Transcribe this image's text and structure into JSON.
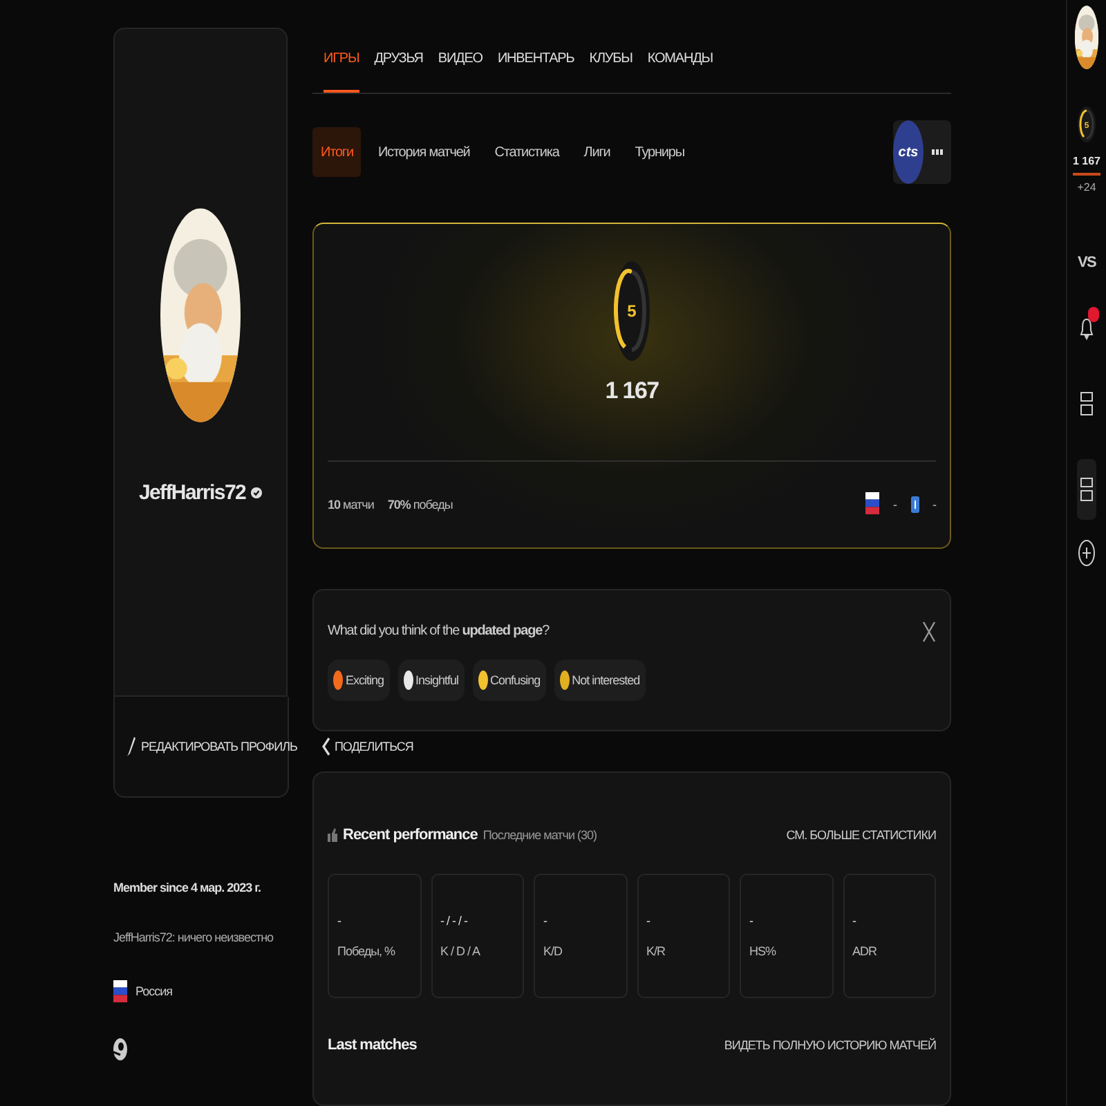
{
  "main_tabs": [
    {
      "label": "ИГРЫ",
      "selected": true
    },
    {
      "label": "ДРУЗЬЯ",
      "selected": false
    },
    {
      "label": "ВИДЕО",
      "selected": false
    },
    {
      "label": "ИНВЕНТАРЬ",
      "selected": false
    },
    {
      "label": "КЛУБЫ",
      "selected": false
    },
    {
      "label": "КОМАНДЫ",
      "selected": false
    }
  ],
  "sub_tabs": [
    {
      "label": "Итоги",
      "selected": true
    },
    {
      "label": "История матчей",
      "selected": false
    },
    {
      "label": "Статистика",
      "selected": false
    },
    {
      "label": "Лиги",
      "selected": false
    },
    {
      "label": "Турниры",
      "selected": false
    }
  ],
  "game_badge": "cts",
  "overview": {
    "level": "5",
    "elo": "1 167",
    "matches": "**10** матчи",
    "winrate": "**70%** победы",
    "country_value": "-",
    "region_value": "-"
  },
  "feedback": {
    "question": "What did you think of the **updated page**?",
    "options": [
      {
        "label": "Exciting",
        "color": "#f26b1d"
      },
      {
        "label": "Insightful",
        "color": "#e8e8e8"
      },
      {
        "label": "Confusing",
        "color": "#f2c12e"
      },
      {
        "label": "Not interested",
        "color": "#e0b020"
      }
    ]
  },
  "profile": {
    "name": "JeffHarris72",
    "edit_button": "РЕДАКТИРОВАТЬ ПРОФИЛЬ",
    "share_button": "ПОДЕЛИТЬСЯ",
    "member_since": "Member since 4 мар. 2023 г.",
    "bio": "JeffHarris72: ничего неизвестно",
    "country": "Россия"
  },
  "performance": {
    "title": "Recent performance",
    "subtitle": "Последние матчи (30)",
    "more_link": "СМ. БОЛЬШЕ СТАТИСТИКИ",
    "stats": [
      {
        "value": "-",
        "label": "Победы, %"
      },
      {
        "value": "- / - / -",
        "label": "K / D / A"
      },
      {
        "value": "-",
        "label": "K/D"
      },
      {
        "value": "-",
        "label": "K/R"
      },
      {
        "value": "-",
        "label": "HS%"
      },
      {
        "value": "-",
        "label": "ADR"
      }
    ],
    "last_matches": "Last matches",
    "history_link": "ВИДЕТЬ ПОЛНУЮ ИСТОРИЮ МАТЧЕЙ"
  },
  "rail": {
    "level": "5",
    "elo": "1 167",
    "change": "+24",
    "vs": "VS"
  }
}
